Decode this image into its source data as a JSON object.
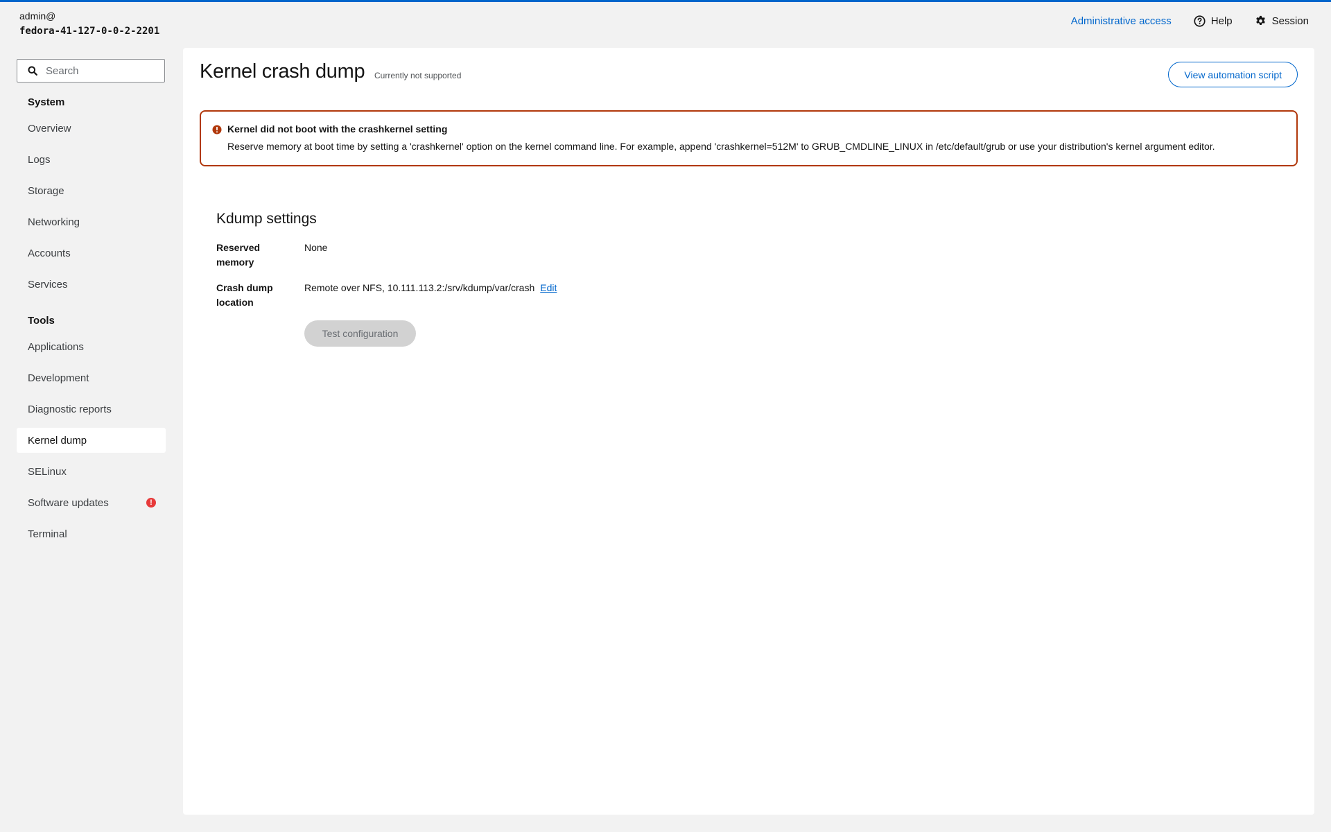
{
  "header": {
    "user": "admin@",
    "hostname": "fedora-41-127-0-0-2-2201",
    "admin_access": "Administrative access",
    "help": "Help",
    "session": "Session"
  },
  "sidebar": {
    "search_placeholder": "Search",
    "system_label": "System",
    "system_items": [
      "Overview",
      "Logs",
      "Storage",
      "Networking",
      "Accounts",
      "Services"
    ],
    "tools_label": "Tools",
    "tools_items": [
      "Applications",
      "Development",
      "Diagnostic reports",
      "Kernel dump",
      "SELinux",
      "Software updates",
      "Terminal"
    ],
    "active_item": "Kernel dump"
  },
  "page": {
    "title": "Kernel crash dump",
    "subtitle": "Currently not supported",
    "automation_button": "View automation script",
    "alert": {
      "title": "Kernel did not boot with the crashkernel setting",
      "body": "Reserve memory at boot time by setting a 'crashkernel' option on the kernel command line. For example, append 'crashkernel=512M' to GRUB_CMDLINE_LINUX in /etc/default/grub or use your distribution's kernel argument editor."
    },
    "kdump": {
      "title": "Kdump settings",
      "reserved_label": "Reserved memory",
      "reserved_value": "None",
      "location_label": "Crash dump location",
      "location_value": "Remote over NFS, 10.111.113.2:/srv/kdump/var/crash",
      "edit_label": "Edit",
      "test_button": "Test configuration"
    }
  },
  "colors": {
    "accent": "#0066cc",
    "danger": "#b1380b",
    "badge": "#e73a3a"
  }
}
